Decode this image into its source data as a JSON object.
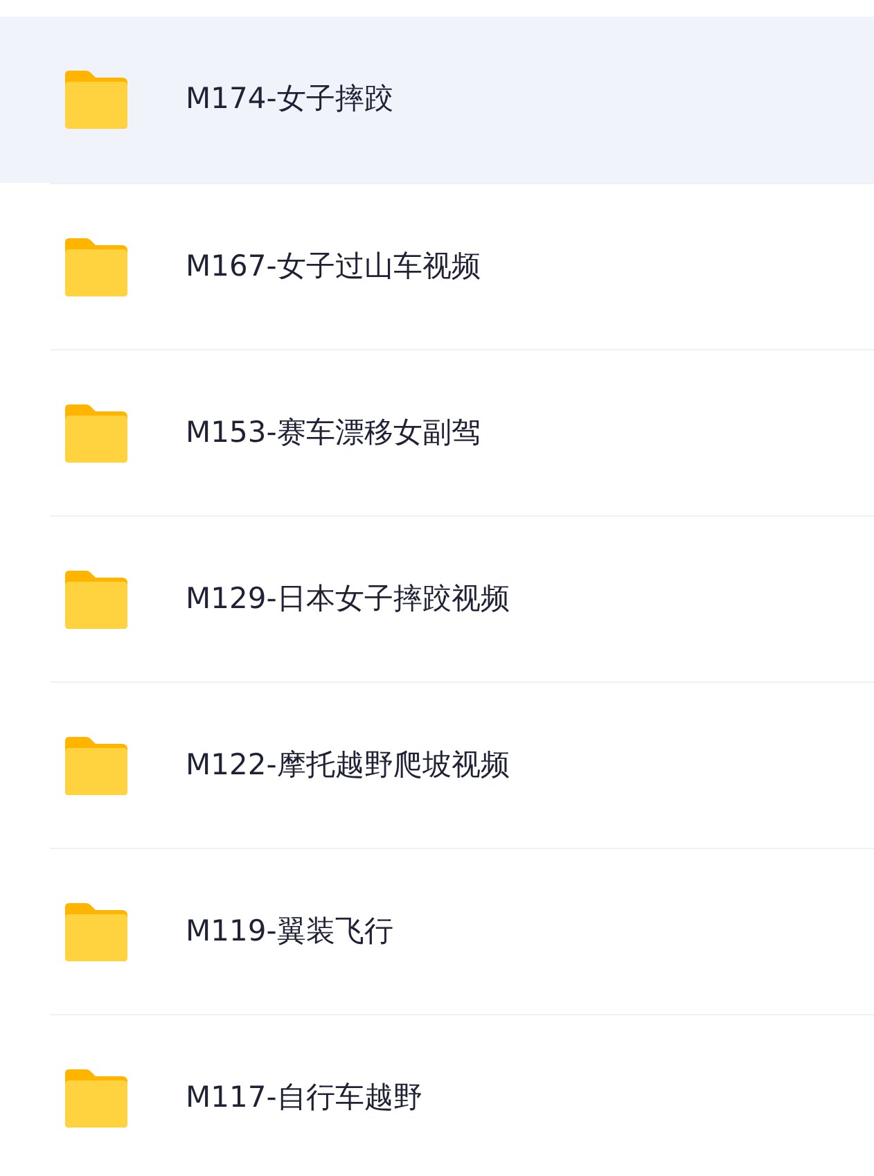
{
  "folders": [
    {
      "name": "M174-女子摔跤",
      "selected": true
    },
    {
      "name": "M167-女子过山车视频",
      "selected": false
    },
    {
      "name": "M153-赛车漂移女副驾",
      "selected": false
    },
    {
      "name": "M129-日本女子摔跤视频",
      "selected": false
    },
    {
      "name": "M122-摩托越野爬坡视频",
      "selected": false
    },
    {
      "name": "M119-翼装飞行",
      "selected": false
    },
    {
      "name": "M117-自行车越野",
      "selected": false
    }
  ]
}
